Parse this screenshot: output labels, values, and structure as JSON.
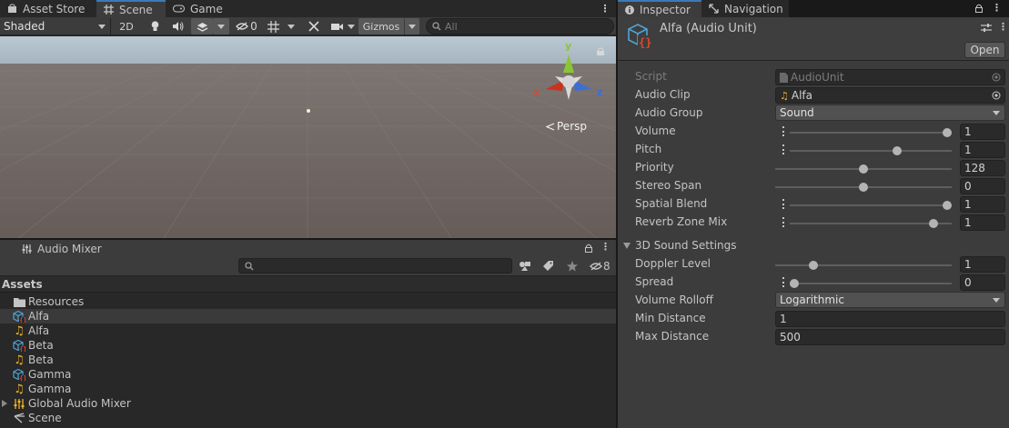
{
  "top_tabs": {
    "asset_store": "Asset Store",
    "scene": "Scene",
    "game": "Game"
  },
  "scene_toolbar": {
    "shading_mode": "Shaded",
    "toggle_2d": "2D",
    "hidden_count": "0",
    "gizmos": "Gizmos",
    "search_placeholder": "All"
  },
  "scene_view": {
    "projection_label": "Persp",
    "gizmo_axes": {
      "x": "x",
      "y": "y",
      "z": "z"
    },
    "colors": {
      "sky": "#a8b6c2",
      "ground": "#6b5f5a",
      "x_axis": "#c8321f",
      "y_axis": "#8ac634",
      "z_axis": "#3b6fd6"
    }
  },
  "audio_mixer_panel": {
    "tab_label": "Audio Mixer",
    "hidden_count": "8",
    "assets_header": "Assets",
    "items": [
      {
        "name": "Resources",
        "icon": "folder-icon",
        "selected": false,
        "expandable": false
      },
      {
        "name": "Alfa",
        "icon": "audio-unit-script-icon",
        "selected": true,
        "expandable": false
      },
      {
        "name": "Alfa",
        "icon": "audio-clip-icon",
        "selected": false,
        "expandable": false
      },
      {
        "name": "Beta",
        "icon": "audio-unit-script-icon",
        "selected": false,
        "expandable": false
      },
      {
        "name": "Beta",
        "icon": "audio-clip-icon",
        "selected": false,
        "expandable": false
      },
      {
        "name": "Gamma",
        "icon": "audio-unit-script-icon",
        "selected": false,
        "expandable": false
      },
      {
        "name": "Gamma",
        "icon": "audio-clip-icon",
        "selected": false,
        "expandable": false
      },
      {
        "name": "Global Audio Mixer",
        "icon": "audio-mixer-icon",
        "selected": false,
        "expandable": true
      },
      {
        "name": "Scene",
        "icon": "scene-icon",
        "selected": false,
        "expandable": false
      }
    ]
  },
  "inspector": {
    "tabs": {
      "inspector": "Inspector",
      "navigation": "Navigation"
    },
    "title": "Alfa (Audio Unit)",
    "open_button": "Open",
    "script": {
      "label": "Script",
      "value": "AudioUnit"
    },
    "audio_clip": {
      "label": "Audio Clip",
      "value": "Alfa"
    },
    "audio_group": {
      "label": "Audio Group",
      "value": "Sound"
    },
    "volume": {
      "label": "Volume",
      "value": "1",
      "fraction": 1.0
    },
    "pitch": {
      "label": "Pitch",
      "value": "1",
      "fraction": 0.67
    },
    "priority": {
      "label": "Priority",
      "value": "128",
      "fraction": 0.5
    },
    "stereo_span": {
      "label": "Stereo Span",
      "value": "0",
      "fraction": 0.5
    },
    "spatial_blend": {
      "label": "Spatial Blend",
      "value": "1",
      "fraction": 1.0
    },
    "reverb_zone_mix": {
      "label": "Reverb Zone Mix",
      "value": "1",
      "fraction": 0.91
    },
    "section_3d": "3D Sound Settings",
    "doppler_level": {
      "label": "Doppler Level",
      "value": "1",
      "fraction": 0.2
    },
    "spread": {
      "label": "Spread",
      "value": "0",
      "fraction": 0.0
    },
    "volume_rolloff": {
      "label": "Volume Rolloff",
      "value": "Logarithmic"
    },
    "min_distance": {
      "label": "Min Distance",
      "value": "1"
    },
    "max_distance": {
      "label": "Max Distance",
      "value": "500"
    }
  }
}
